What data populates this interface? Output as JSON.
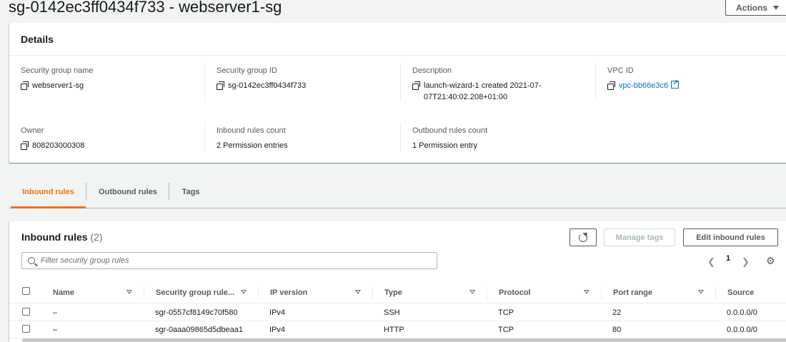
{
  "page": {
    "title": "sg-0142ec3ff0434f733 - webserver1-sg",
    "actions_label": "Actions"
  },
  "details": {
    "header": "Details",
    "security_group_name": {
      "label": "Security group name",
      "value": "webserver1-sg"
    },
    "security_group_id": {
      "label": "Security group ID",
      "value": "sg-0142ec3ff0434f733"
    },
    "description": {
      "label": "Description",
      "value": "launch-wizard-1 created 2021-07-07T21:40:02.208+01:00"
    },
    "vpc_id": {
      "label": "VPC ID",
      "value": "vpc-bb66e3c6"
    },
    "owner": {
      "label": "Owner",
      "value": "808203000308"
    },
    "inbound_rules_count": {
      "label": "Inbound rules count",
      "value": "2 Permission entries"
    },
    "outbound_rules_count": {
      "label": "Outbound rules count",
      "value": "1 Permission entry"
    }
  },
  "tabs": [
    {
      "label": "Inbound rules",
      "active": true
    },
    {
      "label": "Outbound rules",
      "active": false
    },
    {
      "label": "Tags",
      "active": false
    }
  ],
  "inbound": {
    "title": "Inbound rules",
    "count": "(2)",
    "manage_tags_label": "Manage tags",
    "edit_label": "Edit inbound rules",
    "filter_placeholder": "Filter security group rules",
    "page": "1",
    "columns": [
      "Name",
      "Security group rule...",
      "IP version",
      "Type",
      "Protocol",
      "Port range",
      "Source"
    ],
    "rows": [
      {
        "name": "–",
        "rule_id": "sgr-0557cf8149c70f580",
        "ip_version": "IPv4",
        "type": "SSH",
        "protocol": "TCP",
        "port_range": "22",
        "source": "0.0.0.0/0"
      },
      {
        "name": "–",
        "rule_id": "sgr-0aaa09865d5dbeaa1",
        "ip_version": "IPv4",
        "type": "HTTP",
        "protocol": "TCP",
        "port_range": "80",
        "source": "0.0.0.0/0"
      }
    ]
  },
  "colors": {
    "accent_tab": "#ec7211",
    "link": "#0073bb",
    "background": "#f2f3f3"
  },
  "icons": [
    "copy-icon",
    "external-link-icon",
    "refresh-icon",
    "search-icon",
    "chevron-left-icon",
    "chevron-right-icon",
    "gear-icon",
    "sort-icon",
    "caret-down-icon"
  ]
}
